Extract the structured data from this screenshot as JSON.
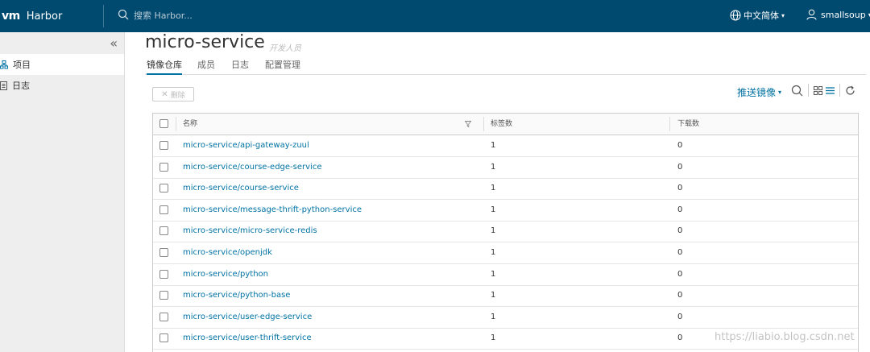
{
  "header": {
    "logo": "vm",
    "app_name": "Harbor",
    "search_placeholder": "搜索 Harbor...",
    "language": "中文简体",
    "user": "smallsoup"
  },
  "sidebar": {
    "items": [
      {
        "label": "项目",
        "icon": "projects-icon",
        "active": true
      },
      {
        "label": "日志",
        "icon": "logs-icon",
        "active": false
      }
    ]
  },
  "project": {
    "title": "micro-service",
    "role": "开发人员"
  },
  "tabs": [
    {
      "label": "镜像仓库"
    },
    {
      "label": "成员"
    },
    {
      "label": "日志"
    },
    {
      "label": "配置管理"
    }
  ],
  "toolbar": {
    "delete_label": "删除",
    "push_label": "推送镜像"
  },
  "table": {
    "columns": [
      "名称",
      "标签数",
      "下载数"
    ],
    "rows": [
      {
        "name": "micro-service/api-gateway-zuul",
        "tags": "1",
        "pulls": "0"
      },
      {
        "name": "micro-service/course-edge-service",
        "tags": "1",
        "pulls": "0"
      },
      {
        "name": "micro-service/course-service",
        "tags": "1",
        "pulls": "0"
      },
      {
        "name": "micro-service/message-thrift-python-service",
        "tags": "1",
        "pulls": "0"
      },
      {
        "name": "micro-service/micro-service-redis",
        "tags": "1",
        "pulls": "0"
      },
      {
        "name": "micro-service/openjdk",
        "tags": "1",
        "pulls": "0"
      },
      {
        "name": "micro-service/python",
        "tags": "1",
        "pulls": "0"
      },
      {
        "name": "micro-service/python-base",
        "tags": "1",
        "pulls": "0"
      },
      {
        "name": "micro-service/user-edge-service",
        "tags": "1",
        "pulls": "0"
      },
      {
        "name": "micro-service/user-thrift-service",
        "tags": "1",
        "pulls": "0"
      }
    ]
  },
  "watermark": "https://liabio.blog.csdn.net",
  "colors": {
    "header_bg": "#004a70",
    "link": "#0072a3",
    "sidebar_bg": "#eeeeee"
  }
}
